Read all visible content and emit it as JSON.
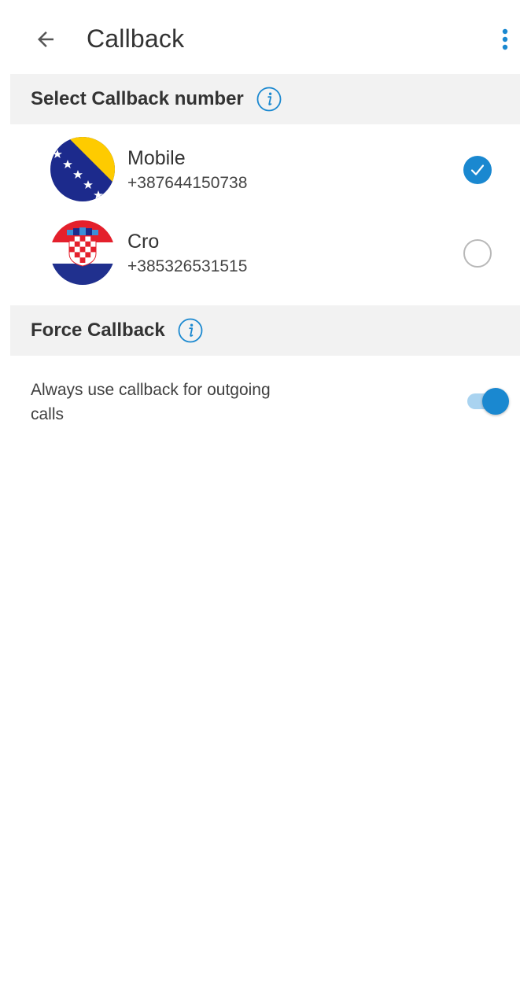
{
  "header": {
    "title": "Callback",
    "back_icon": "arrow-left-icon",
    "menu_icon": "more-vertical-icon"
  },
  "sections": {
    "select_number": {
      "label": "Select Callback number",
      "info_icon": "info-icon"
    },
    "force_callback": {
      "label": "Force Callback",
      "info_icon": "info-icon"
    }
  },
  "numbers": [
    {
      "label": "Mobile",
      "number": "+387644150738",
      "flag": "bosnia-herzegovina-flag-icon",
      "selected": true
    },
    {
      "label": "Cro",
      "number": "+385326531515",
      "flag": "croatia-flag-icon",
      "selected": false
    }
  ],
  "force_callback": {
    "description": "Always use callback for outgoing calls",
    "enabled": true
  },
  "colors": {
    "accent": "#1a88d0",
    "accent_light": "#a9d3f0",
    "section_bg": "#f2f2f2",
    "text": "#333333"
  }
}
